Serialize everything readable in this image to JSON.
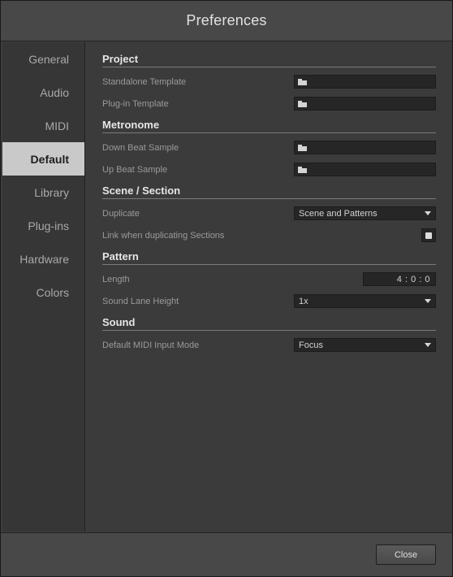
{
  "window": {
    "title": "Preferences"
  },
  "sidebar": {
    "items": [
      {
        "label": "General",
        "active": false
      },
      {
        "label": "Audio",
        "active": false
      },
      {
        "label": "MIDI",
        "active": false
      },
      {
        "label": "Default",
        "active": true
      },
      {
        "label": "Library",
        "active": false
      },
      {
        "label": "Plug-ins",
        "active": false
      },
      {
        "label": "Hardware",
        "active": false
      },
      {
        "label": "Colors",
        "active": false
      }
    ]
  },
  "sections": {
    "project": {
      "title": "Project",
      "standalone_template": {
        "label": "Standalone Template",
        "icon": "folder-icon",
        "value": ""
      },
      "plugin_template": {
        "label": "Plug-in Template",
        "icon": "folder-icon",
        "value": ""
      }
    },
    "metronome": {
      "title": "Metronome",
      "down_beat_sample": {
        "label": "Down Beat Sample",
        "icon": "folder-icon",
        "value": ""
      },
      "up_beat_sample": {
        "label": "Up Beat Sample",
        "icon": "folder-icon",
        "value": ""
      }
    },
    "scene_section": {
      "title": "Scene / Section",
      "duplicate": {
        "label": "Duplicate",
        "value": "Scene and Patterns"
      },
      "link_when_duplicating": {
        "label": "Link when duplicating Sections",
        "checked": true
      }
    },
    "pattern": {
      "title": "Pattern",
      "length": {
        "label": "Length",
        "value": "4 : 0 : 0"
      },
      "sound_lane_height": {
        "label": "Sound Lane Height",
        "value": "1x"
      }
    },
    "sound": {
      "title": "Sound",
      "default_midi_input_mode": {
        "label": "Default MIDI Input Mode",
        "value": "Focus"
      }
    }
  },
  "footer": {
    "close_label": "Close"
  },
  "colors": {
    "background": "#3b3b3b",
    "sidebar": "#363636",
    "active_tab": "#c9c9c9",
    "field": "#262626"
  }
}
